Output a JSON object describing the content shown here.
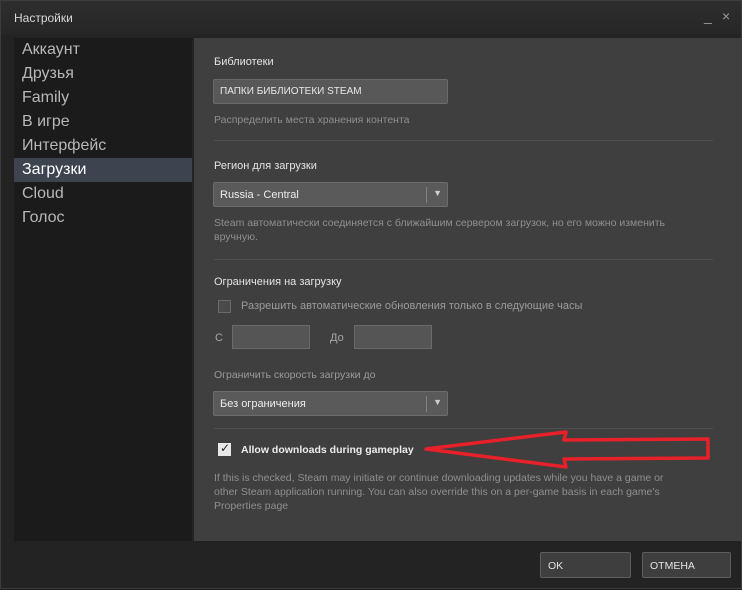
{
  "window": {
    "title": "Настройки",
    "minimize_glyph": "_",
    "close_glyph": "×"
  },
  "sidebar": {
    "items": [
      {
        "label": "Аккаунт",
        "active": false
      },
      {
        "label": "Друзья",
        "active": false
      },
      {
        "label": "Family",
        "active": false
      },
      {
        "label": "В игре",
        "active": false
      },
      {
        "label": "Интерфейс",
        "active": false
      },
      {
        "label": "Загрузки",
        "active": true
      },
      {
        "label": "Cloud",
        "active": false
      },
      {
        "label": "Голос",
        "active": false
      }
    ]
  },
  "libraries": {
    "title": "Библиотеки",
    "button_label": "ПАПКИ БИБЛИОТЕКИ STEAM",
    "description": "Распределить места хранения контента"
  },
  "region": {
    "title": "Регион для загрузки",
    "selected": "Russia - Central",
    "description": "Steam автоматически соединяется с ближайшим сервером загрузок, но его можно изменить вручную."
  },
  "restrictions": {
    "title": "Ограничения на загрузку",
    "auto_update_label": "Разрешить автоматические обновления только в следующие часы",
    "auto_update_checked": false,
    "from_label": "С",
    "to_label": "До",
    "speed_label": "Ограничить скорость загрузки до",
    "speed_selected": "Без ограничения"
  },
  "gameplay": {
    "label": "Allow downloads during gameplay",
    "checked": true,
    "description": "If this is checked, Steam may initiate or continue downloading updates while you have a game or other Steam application running. You can also override this on a per-game basis in each game's Properties page"
  },
  "annotation": {
    "arrow_color": "#e8202a"
  },
  "footer": {
    "ok_label": "OK",
    "cancel_label": "ОТМЕНА"
  },
  "colors": {
    "active_nav": "#3d4450",
    "panel": "#3f3f3f",
    "sidebar": "#1b1b1b"
  }
}
